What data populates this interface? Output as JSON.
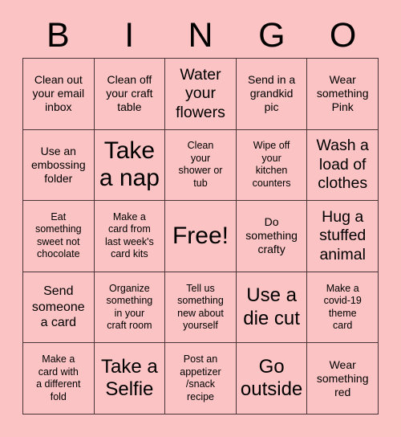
{
  "header": {
    "letters": [
      "B",
      "I",
      "N",
      "G",
      "O"
    ]
  },
  "colors": {
    "background": "#fbc3c3",
    "cell_background": "#fbc3c3",
    "border": "#4a3336",
    "text": "#000000"
  },
  "grid": {
    "rows": 5,
    "columns": 5,
    "cells": [
      {
        "text": "Clean out\nyour email\ninbox",
        "size": "s"
      },
      {
        "text": "Clean off\nyour craft\ntable",
        "size": "s"
      },
      {
        "text": "Water\nyour\nflowers",
        "size": "l"
      },
      {
        "text": "Send in a\ngrandkid\npic",
        "size": "s"
      },
      {
        "text": "Wear\nsomething\nPink",
        "size": "s"
      },
      {
        "text": "Use an\nembossing\nfolder",
        "size": "s"
      },
      {
        "text": "Take\na nap",
        "size": "xxl"
      },
      {
        "text": "Clean\nyour\nshower or\ntub",
        "size": "xs"
      },
      {
        "text": "Wipe off\nyour\nkitchen\ncounters",
        "size": "xs"
      },
      {
        "text": "Wash a\nload of\nclothes",
        "size": "l"
      },
      {
        "text": "Eat\nsomething\nsweet not\nchocolate",
        "size": "xs"
      },
      {
        "text": "Make a\ncard from\nlast week's\ncard kits",
        "size": "xs"
      },
      {
        "text": "Free!",
        "size": "xxl"
      },
      {
        "text": "Do\nsomething\ncrafty",
        "size": "s"
      },
      {
        "text": "Hug a\nstuffed\nanimal",
        "size": "l"
      },
      {
        "text": "Send\nsomeone\na card",
        "size": "m"
      },
      {
        "text": "Organize\nsomething\nin your\ncraft room",
        "size": "xs"
      },
      {
        "text": "Tell us\nsomething\nnew about\nyourself",
        "size": "xs"
      },
      {
        "text": "Use a\ndie cut",
        "size": "xl"
      },
      {
        "text": "Make a\ncovid-19\ntheme\ncard",
        "size": "xs"
      },
      {
        "text": "Make a\ncard with\na different\nfold",
        "size": "xs"
      },
      {
        "text": "Take a\nSelfie",
        "size": "xl"
      },
      {
        "text": "Post an\nappetizer\n/snack\nrecipe",
        "size": "xs"
      },
      {
        "text": "Go\noutside",
        "size": "xl"
      },
      {
        "text": "Wear\nsomething\nred",
        "size": "s"
      }
    ]
  }
}
